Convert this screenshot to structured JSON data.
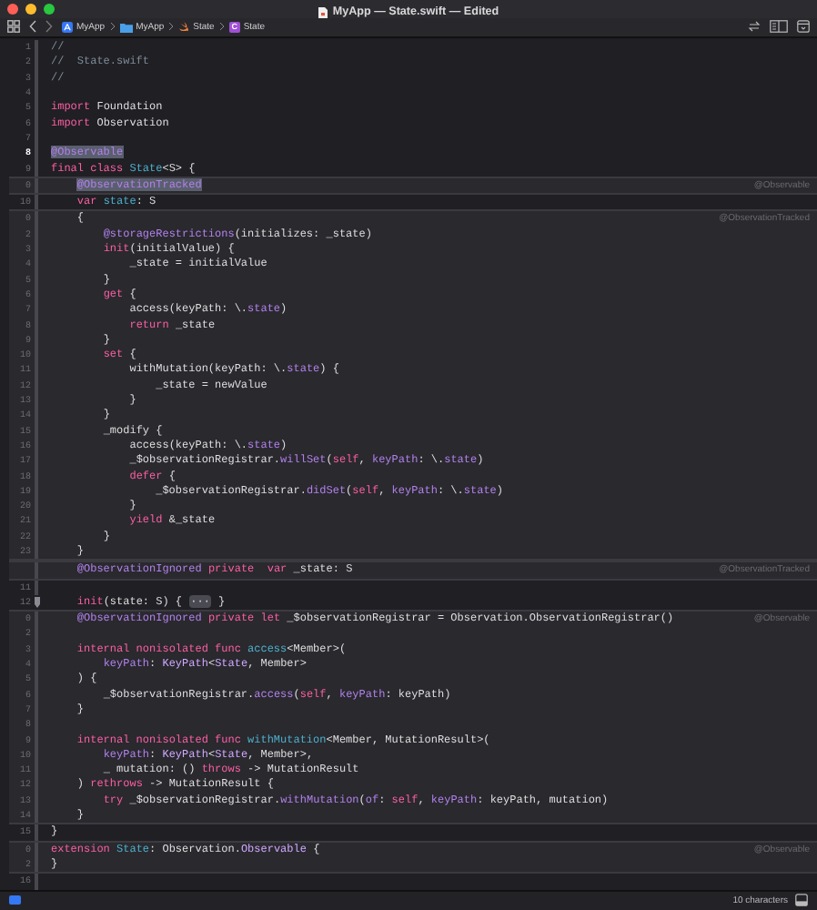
{
  "window": {
    "title": "MyApp — State.swift — Edited"
  },
  "breadcrumb": [
    {
      "kind": "app",
      "text": "MyApp"
    },
    {
      "kind": "folder",
      "text": "MyApp"
    },
    {
      "kind": "swift",
      "text": "State"
    },
    {
      "kind": "class",
      "badge": "C",
      "text": "State"
    }
  ],
  "editor": {
    "blocks": [
      {
        "kind": "code",
        "lines": [
          {
            "number": "1",
            "tokens": [
              {
                "kind": "comment",
                "text": "//"
              }
            ]
          },
          {
            "number": "2",
            "tokens": [
              {
                "kind": "comment",
                "text": "//  State.swift"
              }
            ]
          },
          {
            "number": "3",
            "tokens": [
              {
                "kind": "comment",
                "text": "//"
              }
            ]
          },
          {
            "number": "4"
          },
          {
            "number": "5",
            "tokens": [
              {
                "kind": "keyword",
                "text": "import"
              },
              {
                "kind": "plain",
                "text": " Foundation"
              }
            ]
          },
          {
            "number": "6",
            "tokens": [
              {
                "kind": "keyword",
                "text": "import"
              },
              {
                "kind": "plain",
                "text": " Observation"
              }
            ]
          },
          {
            "number": "7"
          },
          {
            "number": "8",
            "current": true,
            "tokens": [
              {
                "kind": "attribute",
                "text": "@Observable",
                "highlighted": true
              }
            ]
          },
          {
            "number": "9",
            "tokens": [
              {
                "kind": "keyword",
                "text": "final class "
              },
              {
                "kind": "decl",
                "text": "State"
              },
              {
                "kind": "plain",
                "text": "<S> {"
              }
            ]
          }
        ]
      },
      {
        "kind": "expansion",
        "label": "@Observable",
        "lines": [
          {
            "number": "0",
            "tokens": [
              {
                "kind": "attribute",
                "text": "    @ObservationTracked",
                "highlighted": true
              }
            ]
          }
        ]
      },
      {
        "kind": "code",
        "lines": [
          {
            "number": "10",
            "tokens": [
              {
                "kind": "keyword",
                "text": "    var "
              },
              {
                "kind": "decl",
                "text": "state"
              },
              {
                "kind": "plain",
                "text": ": S"
              }
            ]
          }
        ]
      },
      {
        "kind": "expansion",
        "label": "@ObservationTracked",
        "lines": [
          {
            "number": "0",
            "tokens": [
              {
                "kind": "plain",
                "text": "    {"
              }
            ]
          },
          {
            "number": "2",
            "tokens": [
              {
                "kind": "attribute",
                "text": "        @storageRestrictions"
              },
              {
                "kind": "plain",
                "text": "(initializes: _state)"
              }
            ]
          },
          {
            "number": "3",
            "tokens": [
              {
                "kind": "keyword",
                "text": "        init"
              },
              {
                "kind": "plain",
                "text": "(initialValue) {"
              }
            ]
          },
          {
            "number": "4",
            "tokens": [
              {
                "kind": "plain",
                "text": "            _state = initialValue"
              }
            ]
          },
          {
            "number": "5",
            "tokens": [
              {
                "kind": "plain",
                "text": "        }"
              }
            ]
          },
          {
            "number": "6",
            "tokens": [
              {
                "kind": "keyword",
                "text": "        get"
              },
              {
                "kind": "plain",
                "text": " {"
              }
            ]
          },
          {
            "number": "7",
            "tokens": [
              {
                "kind": "plain",
                "text": "            access(keyPath: \\."
              },
              {
                "kind": "member",
                "text": "state"
              },
              {
                "kind": "plain",
                "text": ")"
              }
            ]
          },
          {
            "number": "8",
            "tokens": [
              {
                "kind": "keyword",
                "text": "            return"
              },
              {
                "kind": "plain",
                "text": " _state"
              }
            ]
          },
          {
            "number": "9",
            "tokens": [
              {
                "kind": "plain",
                "text": "        }"
              }
            ]
          },
          {
            "number": "10",
            "tokens": [
              {
                "kind": "keyword",
                "text": "        set"
              },
              {
                "kind": "plain",
                "text": " {"
              }
            ]
          },
          {
            "number": "11",
            "tokens": [
              {
                "kind": "plain",
                "text": "            withMutation(keyPath: \\."
              },
              {
                "kind": "member",
                "text": "state"
              },
              {
                "kind": "plain",
                "text": ") {"
              }
            ]
          },
          {
            "number": "12",
            "tokens": [
              {
                "kind": "plain",
                "text": "                _state = newValue"
              }
            ]
          },
          {
            "number": "13",
            "tokens": [
              {
                "kind": "plain",
                "text": "            }"
              }
            ]
          },
          {
            "number": "14",
            "tokens": [
              {
                "kind": "plain",
                "text": "        }"
              }
            ]
          },
          {
            "number": "15",
            "tokens": [
              {
                "kind": "plain",
                "text": "        _modify {"
              }
            ]
          },
          {
            "number": "16",
            "tokens": [
              {
                "kind": "plain",
                "text": "            access(keyPath: \\."
              },
              {
                "kind": "member",
                "text": "state"
              },
              {
                "kind": "plain",
                "text": ")"
              }
            ]
          },
          {
            "number": "17",
            "tokens": [
              {
                "kind": "plain",
                "text": "            _$observationRegistrar."
              },
              {
                "kind": "member",
                "text": "willSet"
              },
              {
                "kind": "plain",
                "text": "("
              },
              {
                "kind": "keyword",
                "text": "self"
              },
              {
                "kind": "plain",
                "text": ", "
              },
              {
                "kind": "member",
                "text": "keyPath"
              },
              {
                "kind": "plain",
                "text": ": \\."
              },
              {
                "kind": "member",
                "text": "state"
              },
              {
                "kind": "plain",
                "text": ")"
              }
            ]
          },
          {
            "number": "18",
            "tokens": [
              {
                "kind": "keyword",
                "text": "            defer"
              },
              {
                "kind": "plain",
                "text": " {"
              }
            ]
          },
          {
            "number": "19",
            "tokens": [
              {
                "kind": "plain",
                "text": "                _$observationRegistrar."
              },
              {
                "kind": "member",
                "text": "didSet"
              },
              {
                "kind": "plain",
                "text": "("
              },
              {
                "kind": "keyword",
                "text": "self"
              },
              {
                "kind": "plain",
                "text": ", "
              },
              {
                "kind": "member",
                "text": "keyPath"
              },
              {
                "kind": "plain",
                "text": ": \\."
              },
              {
                "kind": "member",
                "text": "state"
              },
              {
                "kind": "plain",
                "text": ")"
              }
            ]
          },
          {
            "number": "20",
            "tokens": [
              {
                "kind": "plain",
                "text": "            }"
              }
            ]
          },
          {
            "number": "21",
            "tokens": [
              {
                "kind": "keyword",
                "text": "            yield"
              },
              {
                "kind": "plain",
                "text": " &_state"
              }
            ]
          },
          {
            "number": "22",
            "tokens": [
              {
                "kind": "plain",
                "text": "        }"
              }
            ]
          },
          {
            "number": "23",
            "tokens": [
              {
                "kind": "plain",
                "text": "    }"
              }
            ]
          }
        ]
      },
      {
        "kind": "expansion",
        "label": "@ObservationTracked",
        "lines": [
          {
            "tokens": [
              {
                "kind": "attribute",
                "text": "    @ObservationIgnored"
              },
              {
                "kind": "keyword",
                "text": " private  var"
              },
              {
                "kind": "plain",
                "text": " _state: S"
              }
            ]
          }
        ]
      },
      {
        "kind": "code",
        "lines": [
          {
            "number": "11"
          },
          {
            "number": "12",
            "folded": true,
            "tokens": [
              {
                "kind": "keyword",
                "text": "    init"
              },
              {
                "kind": "plain",
                "text": "(state: S) { "
              },
              {
                "kind": "fold",
                "text": "···"
              },
              {
                "kind": "plain",
                "text": " }"
              }
            ]
          }
        ]
      },
      {
        "kind": "expansion",
        "label": "@Observable",
        "lines": [
          {
            "number": "0",
            "tokens": [
              {
                "kind": "attribute",
                "text": "    @ObservationIgnored"
              },
              {
                "kind": "keyword",
                "text": " private let"
              },
              {
                "kind": "plain",
                "text": " _$observationRegistrar = Observation.ObservationRegistrar()"
              }
            ]
          },
          {
            "number": "2"
          },
          {
            "number": "3",
            "tokens": [
              {
                "kind": "keyword",
                "text": "    internal nonisolated func "
              },
              {
                "kind": "decl",
                "text": "access"
              },
              {
                "kind": "plain",
                "text": "<Member>("
              }
            ]
          },
          {
            "number": "4",
            "tokens": [
              {
                "kind": "member",
                "text": "        keyPath"
              },
              {
                "kind": "plain",
                "text": ": "
              },
              {
                "kind": "type",
                "text": "KeyPath"
              },
              {
                "kind": "plain",
                "text": "<"
              },
              {
                "kind": "type",
                "text": "State"
              },
              {
                "kind": "plain",
                "text": ", Member>"
              }
            ]
          },
          {
            "number": "5",
            "tokens": [
              {
                "kind": "plain",
                "text": "    ) {"
              }
            ]
          },
          {
            "number": "6",
            "tokens": [
              {
                "kind": "plain",
                "text": "        _$observationRegistrar."
              },
              {
                "kind": "member",
                "text": "access"
              },
              {
                "kind": "plain",
                "text": "("
              },
              {
                "kind": "keyword",
                "text": "self"
              },
              {
                "kind": "plain",
                "text": ", "
              },
              {
                "kind": "member",
                "text": "keyPath"
              },
              {
                "kind": "plain",
                "text": ": keyPath)"
              }
            ]
          },
          {
            "number": "7",
            "tokens": [
              {
                "kind": "plain",
                "text": "    }"
              }
            ]
          },
          {
            "number": "8"
          },
          {
            "number": "9",
            "tokens": [
              {
                "kind": "keyword",
                "text": "    internal nonisolated func "
              },
              {
                "kind": "decl",
                "text": "withMutation"
              },
              {
                "kind": "plain",
                "text": "<Member, MutationResult>("
              }
            ]
          },
          {
            "number": "10",
            "tokens": [
              {
                "kind": "member",
                "text": "        keyPath"
              },
              {
                "kind": "plain",
                "text": ": "
              },
              {
                "kind": "type",
                "text": "KeyPath"
              },
              {
                "kind": "plain",
                "text": "<"
              },
              {
                "kind": "type",
                "text": "State"
              },
              {
                "kind": "plain",
                "text": ", Member>,"
              }
            ]
          },
          {
            "number": "11",
            "tokens": [
              {
                "kind": "plain",
                "text": "        _ mutation: () "
              },
              {
                "kind": "keyword",
                "text": "throws"
              },
              {
                "kind": "plain",
                "text": " -> MutationResult"
              }
            ]
          },
          {
            "number": "12",
            "tokens": [
              {
                "kind": "plain",
                "text": "    ) "
              },
              {
                "kind": "keyword",
                "text": "rethrows"
              },
              {
                "kind": "plain",
                "text": " -> MutationResult {"
              }
            ]
          },
          {
            "number": "13",
            "tokens": [
              {
                "kind": "keyword",
                "text": "        try"
              },
              {
                "kind": "plain",
                "text": " _$observationRegistrar."
              },
              {
                "kind": "member",
                "text": "withMutation"
              },
              {
                "kind": "plain",
                "text": "("
              },
              {
                "kind": "member",
                "text": "of"
              },
              {
                "kind": "plain",
                "text": ": "
              },
              {
                "kind": "keyword",
                "text": "self"
              },
              {
                "kind": "plain",
                "text": ", "
              },
              {
                "kind": "member",
                "text": "keyPath"
              },
              {
                "kind": "plain",
                "text": ": keyPath, mutation)"
              }
            ]
          },
          {
            "number": "14",
            "tokens": [
              {
                "kind": "plain",
                "text": "    }"
              }
            ]
          }
        ]
      },
      {
        "kind": "code",
        "lines": [
          {
            "number": "15",
            "tokens": [
              {
                "kind": "plain",
                "text": "}"
              }
            ]
          }
        ]
      },
      {
        "kind": "expansion",
        "label": "@Observable",
        "lines": [
          {
            "number": "0",
            "tokens": [
              {
                "kind": "keyword",
                "text": "extension "
              },
              {
                "kind": "decl",
                "text": "State"
              },
              {
                "kind": "plain",
                "text": ": Observation."
              },
              {
                "kind": "type",
                "text": "Observable"
              },
              {
                "kind": "plain",
                "text": " {"
              }
            ]
          },
          {
            "number": "2",
            "tokens": [
              {
                "kind": "plain",
                "text": "}"
              }
            ]
          }
        ]
      },
      {
        "kind": "code",
        "lines": [
          {
            "number": "16"
          }
        ]
      }
    ]
  },
  "status_bar": {
    "selection": "10 characters"
  }
}
